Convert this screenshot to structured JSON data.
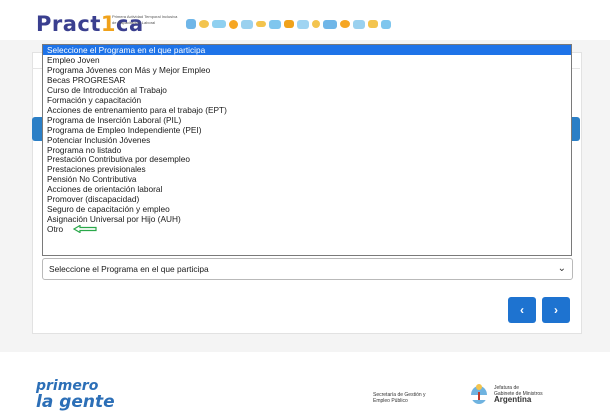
{
  "header": {
    "logo_part1": "Pract",
    "logo_part2": "1",
    "logo_part3": "ca",
    "logo_subtitle": "Primera Actividad Temporal Inclusiva de Capacitación Laboral"
  },
  "dropdown": {
    "options": [
      "Seleccione el Programa en el que participa",
      "Empleo Joven",
      "Programa Jóvenes con Más y Mejor Empleo",
      "Becas PROGRESAR",
      "Curso de Introducción al Trabajo",
      "Formación y capacitación",
      "Acciones de entrenamiento para el trabajo (EPT)",
      "Programa de Inserción Laboral (PIL)",
      "Programa de Empleo Independiente (PEI)",
      "Potenciar Inclusión Jóvenes",
      "Programa no listado",
      "Prestación Contributiva por desempleo",
      "Prestaciones previsionales",
      "Pensión No Contributiva",
      "Acciones de orientación laboral",
      "Promover (discapacidad)",
      "Seguro de capacitación y empleo",
      "Asignación Universal por Hijo (AUH)",
      "Otro"
    ],
    "selected_index": 0
  },
  "select": {
    "value": "Seleccione el Programa en el que participa"
  },
  "nav": {
    "prev": "‹",
    "next": "›"
  },
  "footer": {
    "brand_line1": "primero",
    "brand_line2": "la gente",
    "secretaria": "Secretaría de Gestión y Empleo Público",
    "jefatura_line1": "Jefatura de",
    "jefatura_line2": "Gabinete de Ministros",
    "jefatura_line3": "Argentina"
  },
  "colors": {
    "accent": "#1e73e8",
    "arrow": "#2aa84a",
    "logo_blue": "#3a3f8f",
    "logo_orange": "#f0a21b"
  }
}
